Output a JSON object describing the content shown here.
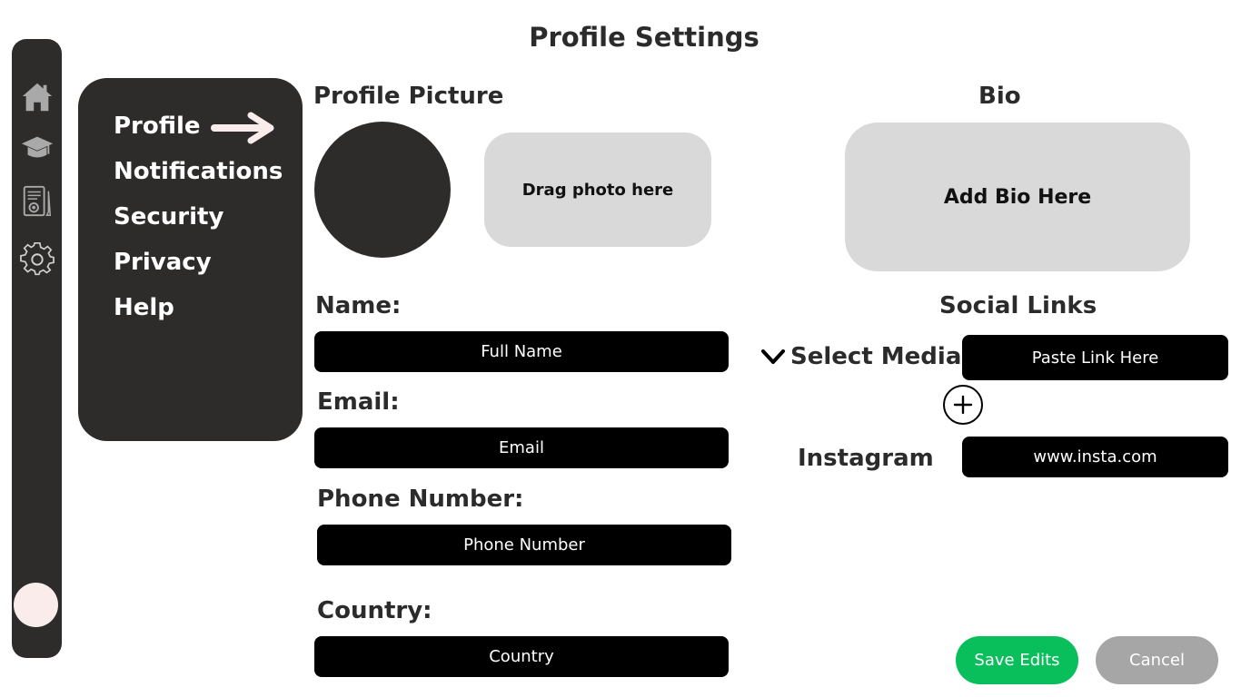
{
  "page": {
    "title": "Profile Settings"
  },
  "rail": {
    "icons": [
      "home-icon",
      "graduation-cap-icon",
      "document-settings-icon",
      "gear-icon"
    ],
    "avatar_color": "#fbecec"
  },
  "menu": {
    "items": [
      {
        "label": "Profile",
        "active": true
      },
      {
        "label": "Notifications"
      },
      {
        "label": "Security"
      },
      {
        "label": "Privacy"
      },
      {
        "label": "Help"
      }
    ],
    "indicator": "arrow-right-icon"
  },
  "profile_picture": {
    "heading": "Profile Picture",
    "drop_label": "Drag photo here"
  },
  "bio": {
    "heading": "Bio",
    "placeholder": "Add Bio Here"
  },
  "form": {
    "name": {
      "label": "Name:",
      "placeholder": "Full Name"
    },
    "email": {
      "label": "Email:",
      "placeholder": "Email"
    },
    "phone": {
      "label": "Phone Number:",
      "placeholder": "Phone Number"
    },
    "country": {
      "label": "Country:",
      "placeholder": "Country"
    }
  },
  "social": {
    "heading": "Social Links",
    "select_label": "Select Media",
    "link_placeholder": "Paste Link Here",
    "entries": [
      {
        "platform": "Instagram",
        "link": "www.insta.com"
      }
    ]
  },
  "actions": {
    "save_label": "Save Edits",
    "cancel_label": "Cancel"
  },
  "colors": {
    "dark": "#2e2b2b",
    "field_bg": "#000000",
    "light_gray": "#d9d9d9",
    "save": "#08bf5b",
    "cancel": "#a6a6a6",
    "accent": "#fbecec"
  }
}
